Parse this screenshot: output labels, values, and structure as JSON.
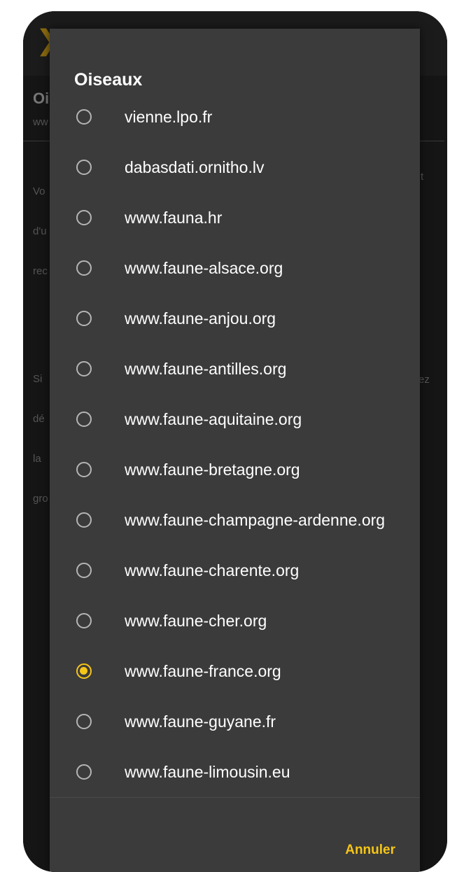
{
  "background": {
    "back_icon": "chevron-left-icon",
    "title_fragment": "Oi",
    "subtitle_fragment": "ww",
    "para1": [
      "Vo",
      "d'u",
      "rec"
    ],
    "para1_right": "t",
    "para2": [
      "Si",
      "dé",
      "la",
      "gro"
    ],
    "para2_right": "ez"
  },
  "dialog": {
    "title": "Oiseaux",
    "options": [
      {
        "label": "vienne.lpo.fr",
        "selected": false
      },
      {
        "label": "dabasdati.ornitho.lv",
        "selected": false
      },
      {
        "label": "www.fauna.hr",
        "selected": false
      },
      {
        "label": "www.faune-alsace.org",
        "selected": false
      },
      {
        "label": "www.faune-anjou.org",
        "selected": false
      },
      {
        "label": "www.faune-antilles.org",
        "selected": false
      },
      {
        "label": "www.faune-aquitaine.org",
        "selected": false
      },
      {
        "label": "www.faune-bretagne.org",
        "selected": false
      },
      {
        "label": "www.faune-champagne-ardenne.org",
        "selected": false
      },
      {
        "label": "www.faune-charente.org",
        "selected": false
      },
      {
        "label": "www.faune-cher.org",
        "selected": false
      },
      {
        "label": "www.faune-france.org",
        "selected": true
      },
      {
        "label": "www.faune-guyane.fr",
        "selected": false
      },
      {
        "label": "www.faune-limousin.eu",
        "selected": false
      }
    ],
    "cancel_label": "Annuler"
  },
  "colors": {
    "accent": "#f5c518",
    "dialog_bg": "#3b3b3b",
    "radio_unchecked": "#b5b5b5"
  }
}
